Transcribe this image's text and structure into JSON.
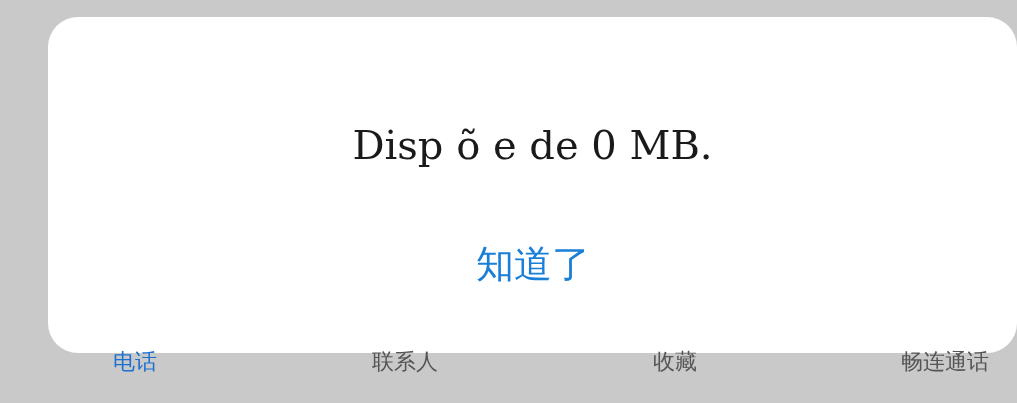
{
  "dialog": {
    "message": "Disp õ e de 0 MB.",
    "button": "知道了"
  },
  "tabs": [
    {
      "label": "电话",
      "selected": true
    },
    {
      "label": "联系人",
      "selected": false
    },
    {
      "label": "收藏",
      "selected": false
    },
    {
      "label": "畅连通话",
      "selected": false
    }
  ]
}
